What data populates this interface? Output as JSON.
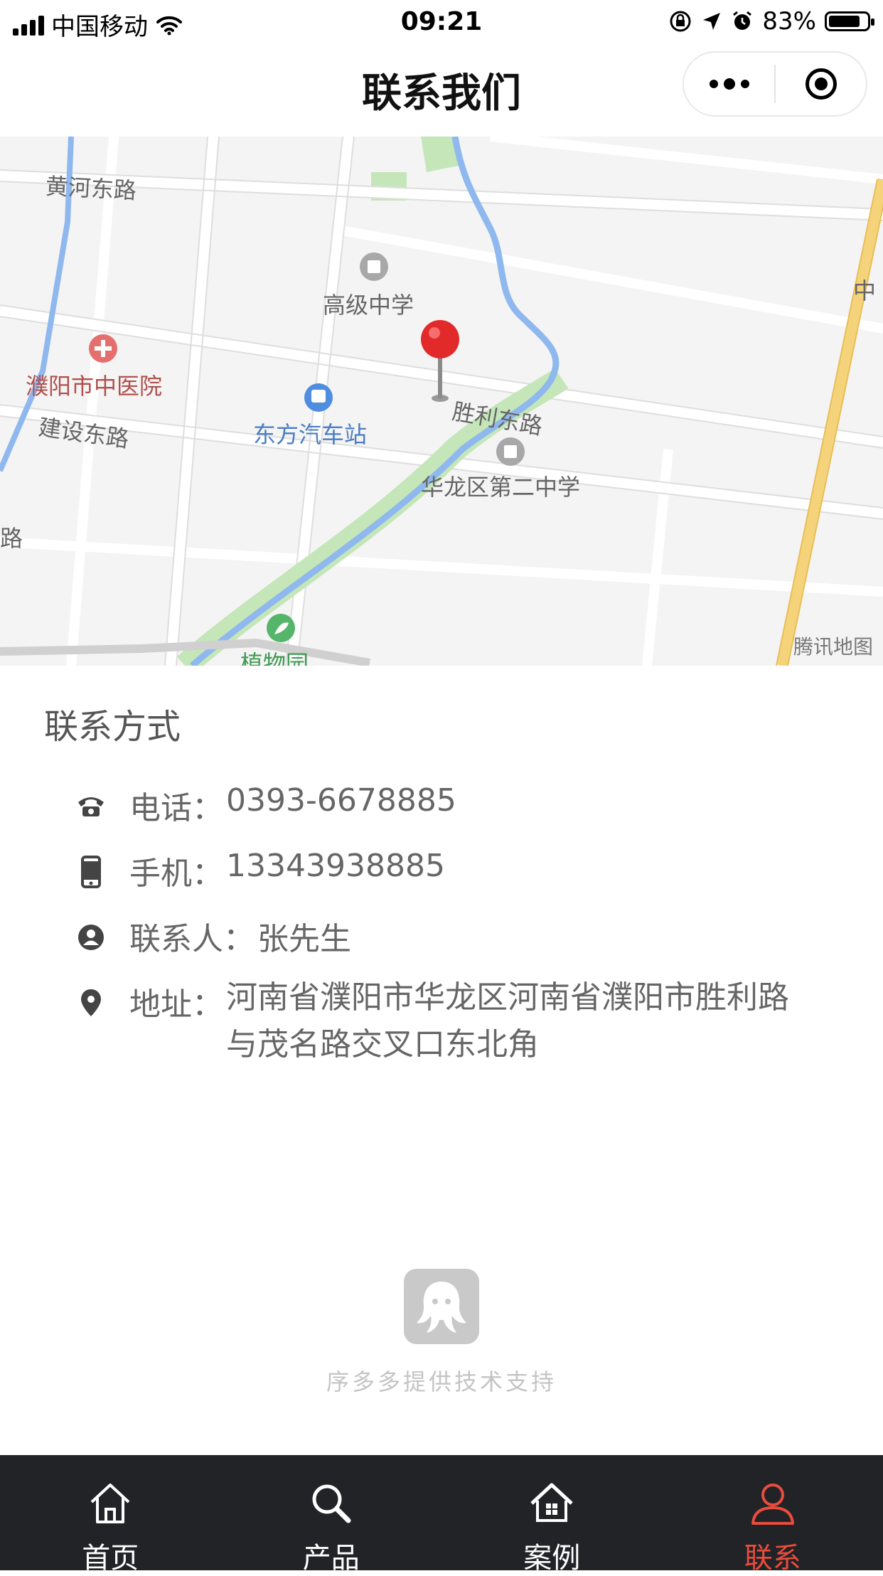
{
  "status_bar": {
    "carrier": "中国移动",
    "time": "09:21",
    "battery": "83%",
    "battery_level": 0.83
  },
  "nav": {
    "title": "联系我们",
    "icons": [
      "more-dots-icon",
      "close-target-icon"
    ]
  },
  "map": {
    "labels": {
      "huanghe": "黄河东路",
      "gaoji": "高级中学",
      "hospital": "濮阳市中医院",
      "jianshe": "建设东路",
      "bus": "东方汽车站",
      "shengli": "胜利东路",
      "erzhong": "华龙区第二中学",
      "lu": "路",
      "garden": "植物园",
      "zhong": "中"
    },
    "credit": "腾讯地图",
    "colors": {
      "river": "#8fb8ee",
      "main_road": "#f5d37a",
      "park": "#c5e6b9",
      "pin": "#e32a2a"
    }
  },
  "contact": {
    "section_title": "联系方式",
    "phone": {
      "label": "电话：",
      "value": "0393-6678885",
      "icon": "phone-icon"
    },
    "mobile": {
      "label": "手机：",
      "value": "13343938885",
      "icon": "mobile-icon"
    },
    "person": {
      "label": "联系人：",
      "value": "张先生",
      "icon": "person-icon"
    },
    "address": {
      "label": "地址：",
      "value": "河南省濮阳市华龙区河南省濮阳市胜利路与茂名路交叉口东北角",
      "icon": "location-icon"
    }
  },
  "support": {
    "text": "序多多提供技术支持",
    "icon": "octopus-logo-icon"
  },
  "tabbar": {
    "tabs": [
      {
        "label": "首页",
        "icon": "home-icon"
      },
      {
        "label": "产品",
        "icon": "search-icon"
      },
      {
        "label": "案例",
        "icon": "store-icon"
      },
      {
        "label": "联系",
        "icon": "user-icon"
      }
    ],
    "active_color": "#e84c3d"
  }
}
